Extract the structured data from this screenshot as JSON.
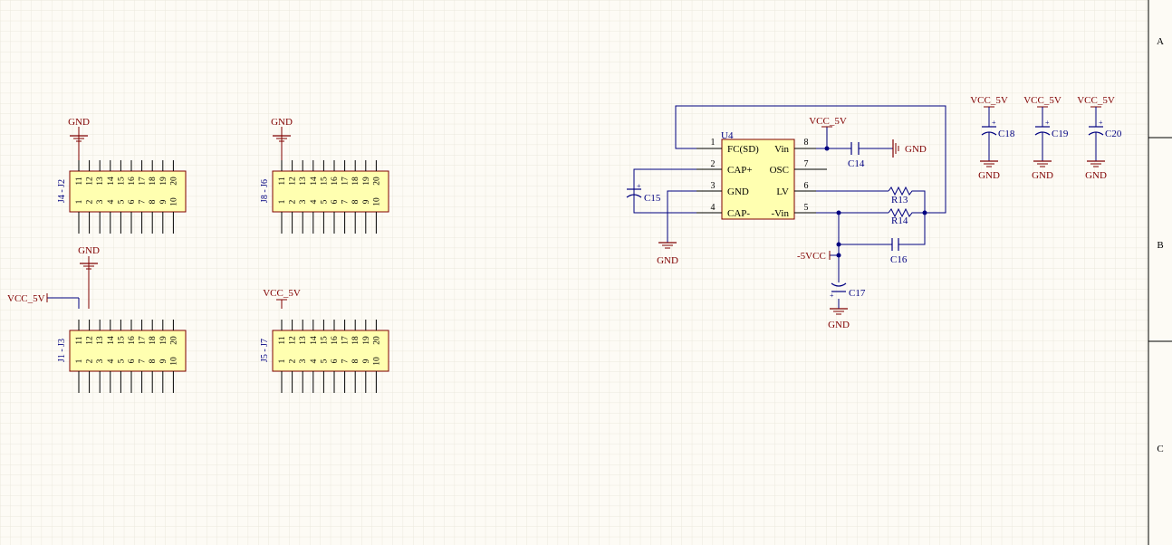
{
  "zones": [
    "A",
    "B",
    "C"
  ],
  "net_labels": {
    "gnd": "GND",
    "vcc_5v": "VCC_5V",
    "neg_5v": "-5VCC"
  },
  "headers": [
    {
      "designator": "J4 - J2",
      "top_pins": [
        "11",
        "12",
        "13",
        "14",
        "15",
        "16",
        "17",
        "18",
        "19",
        "20"
      ],
      "bottom_pins": [
        "1",
        "2",
        "3",
        "4",
        "5",
        "6",
        "7",
        "8",
        "9",
        "10"
      ]
    },
    {
      "designator": "J8 - J6",
      "top_pins": [
        "11",
        "12",
        "13",
        "14",
        "15",
        "16",
        "17",
        "18",
        "19",
        "20"
      ],
      "bottom_pins": [
        "1",
        "2",
        "3",
        "4",
        "5",
        "6",
        "7",
        "8",
        "9",
        "10"
      ]
    },
    {
      "designator": "J1 - J3",
      "top_pins": [
        "11",
        "12",
        "13",
        "14",
        "15",
        "16",
        "17",
        "18",
        "19",
        "20"
      ],
      "bottom_pins": [
        "1",
        "2",
        "3",
        "4",
        "5",
        "6",
        "7",
        "8",
        "9",
        "10"
      ]
    },
    {
      "designator": "J5 - J7",
      "top_pins": [
        "11",
        "12",
        "13",
        "14",
        "15",
        "16",
        "17",
        "18",
        "19",
        "20"
      ],
      "bottom_pins": [
        "1",
        "2",
        "3",
        "4",
        "5",
        "6",
        "7",
        "8",
        "9",
        "10"
      ]
    }
  ],
  "ic": {
    "designator": "U4",
    "left_pins": [
      {
        "num": "1",
        "name": "FC(SD)"
      },
      {
        "num": "2",
        "name": "CAP+"
      },
      {
        "num": "3",
        "name": "GND"
      },
      {
        "num": "4",
        "name": "CAP-"
      }
    ],
    "right_pins": [
      {
        "num": "8",
        "name": "Vin"
      },
      {
        "num": "7",
        "name": "OSC"
      },
      {
        "num": "6",
        "name": "LV"
      },
      {
        "num": "5",
        "name": "-Vin"
      }
    ]
  },
  "components": {
    "c14": "C14",
    "c15": "C15",
    "c16": "C16",
    "c17": "C17",
    "c18": "C18",
    "c19": "C19",
    "c20": "C20",
    "r13": "R13",
    "r14": "R14"
  },
  "colors": {
    "background": "#fdfbf5",
    "grid": "#ebe8dd",
    "wire": "#000080",
    "pin": "#000000",
    "ic_fill": "#ffffb0",
    "ic_border": "#800000",
    "net_label": "#800000",
    "designator": "#000080"
  }
}
